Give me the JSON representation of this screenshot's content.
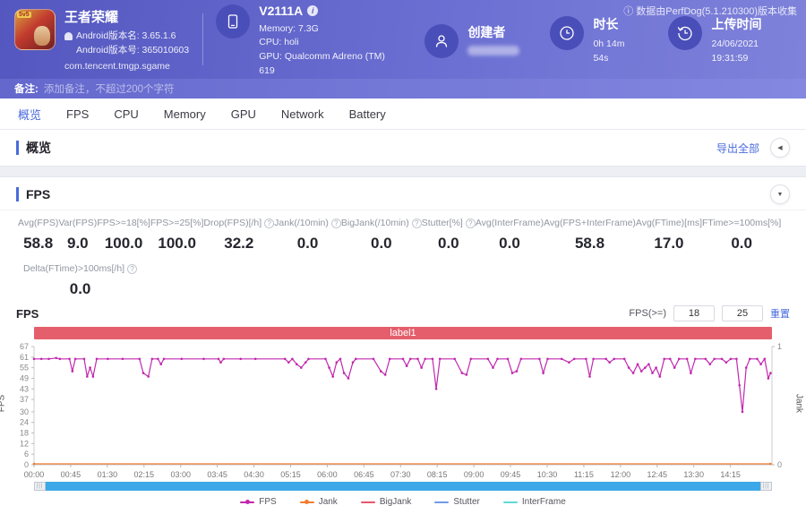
{
  "meta": {
    "brand_note": "数据由PerfDog(5.1.210300)版本收集"
  },
  "header": {
    "game": {
      "name": "王者荣耀",
      "icon_badge": "5v5",
      "version_name": "Android版本名: 3.65.1.6",
      "version_code": "Android版本号: 365010603",
      "package": "com.tencent.tmgp.sgame"
    },
    "device": {
      "name": "V2111A",
      "memory": "Memory: 7.3G",
      "cpu": "CPU: holi",
      "gpu": "GPU: Qualcomm Adreno (TM) 619"
    },
    "creator": {
      "label": "创建者"
    },
    "duration": {
      "label": "时长",
      "value": "0h 14m 54s"
    },
    "upload": {
      "label": "上传时间",
      "value": "24/06/2021 19:31:59"
    }
  },
  "note_bar": {
    "label": "备注:",
    "placeholder": "添加备注，不超过200个字符"
  },
  "tabs": [
    {
      "name": "tab-overview",
      "label": "概览",
      "active": true
    },
    {
      "name": "tab-fps",
      "label": "FPS",
      "active": false
    },
    {
      "name": "tab-cpu",
      "label": "CPU",
      "active": false
    },
    {
      "name": "tab-memory",
      "label": "Memory",
      "active": false
    },
    {
      "name": "tab-gpu",
      "label": "GPU",
      "active": false
    },
    {
      "name": "tab-network",
      "label": "Network",
      "active": false
    },
    {
      "name": "tab-battery",
      "label": "Battery",
      "active": false
    }
  ],
  "overview": {
    "title": "概览",
    "export_label": "导出全部"
  },
  "fps_panel": {
    "title": "FPS",
    "stats": [
      {
        "label": "Avg(FPS)",
        "value": "58.8",
        "help": false
      },
      {
        "label": "Var(FPS)",
        "value": "9.0",
        "help": false
      },
      {
        "label": "FPS>=18[%]",
        "value": "100.0",
        "help": false
      },
      {
        "label": "FPS>=25[%]",
        "value": "100.0",
        "help": false
      },
      {
        "label": "Drop(FPS)[/h]",
        "value": "32.2",
        "help": true
      },
      {
        "label": "Jank(/10min)",
        "value": "0.0",
        "help": true
      },
      {
        "label": "BigJank(/10min)",
        "value": "0.0",
        "help": true
      },
      {
        "label": "Stutter[%]",
        "value": "0.0",
        "help": true
      },
      {
        "label": "Avg(InterFrame)",
        "value": "0.0",
        "help": false
      },
      {
        "label": "Avg(FPS+InterFrame)",
        "value": "58.8",
        "help": false
      },
      {
        "label": "Avg(FTime)[ms]",
        "value": "17.0",
        "help": false
      },
      {
        "label": "FTime>=100ms[%]",
        "value": "0.0",
        "help": false
      }
    ],
    "stats_row2": [
      {
        "label": "Delta(FTime)>100ms[/h]",
        "value": "0.0",
        "help": true
      }
    ]
  },
  "chart_controls": {
    "chart_title": "FPS",
    "threshold_label": "FPS(>=)",
    "threshold1": "18",
    "threshold2": "25",
    "reset_label": "重置"
  },
  "chart_data": {
    "type": "line",
    "title": "label1",
    "title_band_color": "#e45f6b",
    "left_axis": {
      "label": "FPS",
      "ticks": [
        67,
        61,
        55,
        49,
        43,
        37,
        30,
        24,
        18,
        12,
        6,
        0
      ],
      "max": 67,
      "min": 0
    },
    "right_axis": {
      "label": "Jank",
      "ticks": [
        1,
        0
      ],
      "max": 1,
      "min": 0
    },
    "x_ticks": [
      "00:00",
      "00:45",
      "01:30",
      "02:15",
      "03:00",
      "03:45",
      "04:30",
      "05:15",
      "06:00",
      "06:45",
      "07:30",
      "08:15",
      "09:00",
      "09:45",
      "10:30",
      "11:15",
      "12:00",
      "12:45",
      "13:30",
      "14:15"
    ],
    "x_total_minutes": 15.1,
    "grid": false,
    "series": [
      {
        "name": "FPS",
        "color": "#c128ae",
        "marker": true,
        "axis": "left",
        "points": [
          [
            0.0,
            60
          ],
          [
            0.01,
            60
          ],
          [
            0.02,
            60
          ],
          [
            0.03,
            60.5
          ],
          [
            0.035,
            60
          ],
          [
            0.048,
            60
          ],
          [
            0.052,
            53
          ],
          [
            0.056,
            60
          ],
          [
            0.068,
            60
          ],
          [
            0.072,
            50
          ],
          [
            0.076,
            55
          ],
          [
            0.08,
            50
          ],
          [
            0.085,
            60
          ],
          [
            0.1,
            60
          ],
          [
            0.12,
            60
          ],
          [
            0.143,
            60
          ],
          [
            0.148,
            52
          ],
          [
            0.155,
            50
          ],
          [
            0.16,
            60
          ],
          [
            0.168,
            60
          ],
          [
            0.172,
            57
          ],
          [
            0.176,
            60
          ],
          [
            0.2,
            60
          ],
          [
            0.23,
            60
          ],
          [
            0.25,
            60
          ],
          [
            0.253,
            58
          ],
          [
            0.257,
            60
          ],
          [
            0.28,
            60
          ],
          [
            0.3,
            60
          ],
          [
            0.34,
            60
          ],
          [
            0.345,
            58
          ],
          [
            0.35,
            60
          ],
          [
            0.356,
            57
          ],
          [
            0.362,
            55
          ],
          [
            0.368,
            58
          ],
          [
            0.372,
            60
          ],
          [
            0.395,
            60
          ],
          [
            0.4,
            55
          ],
          [
            0.405,
            50
          ],
          [
            0.41,
            58
          ],
          [
            0.415,
            60
          ],
          [
            0.42,
            52
          ],
          [
            0.426,
            49
          ],
          [
            0.432,
            58
          ],
          [
            0.436,
            60
          ],
          [
            0.46,
            60
          ],
          [
            0.47,
            53
          ],
          [
            0.476,
            51
          ],
          [
            0.482,
            60
          ],
          [
            0.5,
            60
          ],
          [
            0.505,
            56
          ],
          [
            0.51,
            60
          ],
          [
            0.52,
            60
          ],
          [
            0.525,
            55
          ],
          [
            0.53,
            60
          ],
          [
            0.54,
            60
          ],
          [
            0.545,
            43
          ],
          [
            0.55,
            60
          ],
          [
            0.57,
            60
          ],
          [
            0.58,
            52
          ],
          [
            0.586,
            51
          ],
          [
            0.592,
            60
          ],
          [
            0.615,
            60
          ],
          [
            0.622,
            55
          ],
          [
            0.628,
            60
          ],
          [
            0.642,
            60
          ],
          [
            0.648,
            52
          ],
          [
            0.654,
            53
          ],
          [
            0.66,
            60
          ],
          [
            0.685,
            60
          ],
          [
            0.69,
            52
          ],
          [
            0.696,
            60
          ],
          [
            0.715,
            60
          ],
          [
            0.725,
            58
          ],
          [
            0.732,
            60
          ],
          [
            0.748,
            60
          ],
          [
            0.753,
            50
          ],
          [
            0.758,
            60
          ],
          [
            0.775,
            60
          ],
          [
            0.78,
            58
          ],
          [
            0.786,
            60
          ],
          [
            0.8,
            60
          ],
          [
            0.806,
            55
          ],
          [
            0.812,
            52
          ],
          [
            0.818,
            57
          ],
          [
            0.823,
            53
          ],
          [
            0.828,
            55
          ],
          [
            0.833,
            57
          ],
          [
            0.838,
            52
          ],
          [
            0.843,
            55
          ],
          [
            0.848,
            50
          ],
          [
            0.854,
            60
          ],
          [
            0.862,
            60
          ],
          [
            0.868,
            55
          ],
          [
            0.874,
            60
          ],
          [
            0.885,
            60
          ],
          [
            0.89,
            52
          ],
          [
            0.896,
            60
          ],
          [
            0.91,
            60
          ],
          [
            0.916,
            57
          ],
          [
            0.922,
            60
          ],
          [
            0.932,
            60
          ],
          [
            0.938,
            58
          ],
          [
            0.944,
            60
          ],
          [
            0.952,
            60
          ],
          [
            0.956,
            45
          ],
          [
            0.96,
            30
          ],
          [
            0.965,
            55
          ],
          [
            0.97,
            60
          ],
          [
            0.98,
            60
          ],
          [
            0.985,
            57
          ],
          [
            0.99,
            60
          ],
          [
            0.995,
            49
          ],
          [
            0.998,
            52
          ]
        ]
      },
      {
        "name": "Jank",
        "color": "#f07c2f",
        "marker": true,
        "axis": "right",
        "points": [
          [
            0.0,
            0
          ],
          [
            0.998,
            0
          ]
        ]
      }
    ],
    "legend": [
      {
        "name": "FPS",
        "color": "#c128ae",
        "marker": true
      },
      {
        "name": "Jank",
        "color": "#f07c2f",
        "marker": true
      },
      {
        "name": "BigJank",
        "color": "#e8566a",
        "marker": false
      },
      {
        "name": "Stutter",
        "color": "#6f9be8",
        "marker": false
      },
      {
        "name": "InterFrame",
        "color": "#5fd8d8",
        "marker": false
      }
    ],
    "legend_position": "bottom"
  }
}
